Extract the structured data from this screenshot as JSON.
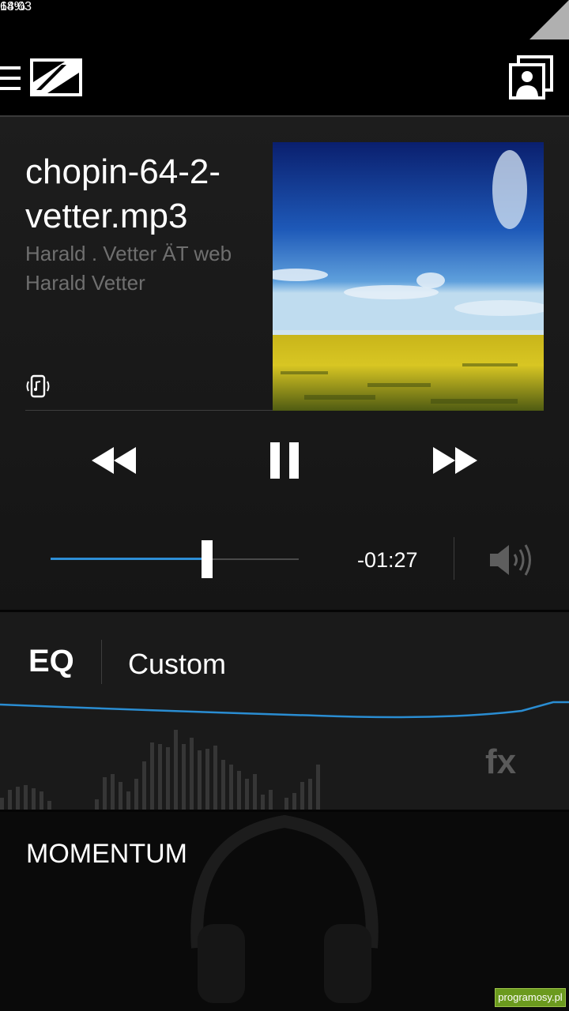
{
  "status_bar": {
    "battery": "64%",
    "time": "18:03",
    "signal_icon": "signal-icon"
  },
  "action_bar": {
    "menu_icon": "menu-icon",
    "logo": "sennheiser-logo",
    "profile_icon": "profile-icon"
  },
  "now_playing": {
    "title": "chopin-64-2-vetter.mp3",
    "artist": "Harald . Vetter ÄT web",
    "album": "Harald Vetter",
    "source_icon": "device-music-icon",
    "artwork": "field-landscape-artwork"
  },
  "controls": {
    "rewind": "rewind-icon",
    "pause": "pause-icon",
    "forward": "fast-forward-icon"
  },
  "seek": {
    "progress": 0.63,
    "remaining": "-01:27",
    "accent": "#2e8fd6"
  },
  "volume": {
    "icon": "volume-icon"
  },
  "eq": {
    "label": "EQ",
    "preset": "Custom",
    "fx": "fx"
  },
  "bottom": {
    "title": "MOMENTUM"
  },
  "watermark": {
    "text": "programosy.pl"
  }
}
